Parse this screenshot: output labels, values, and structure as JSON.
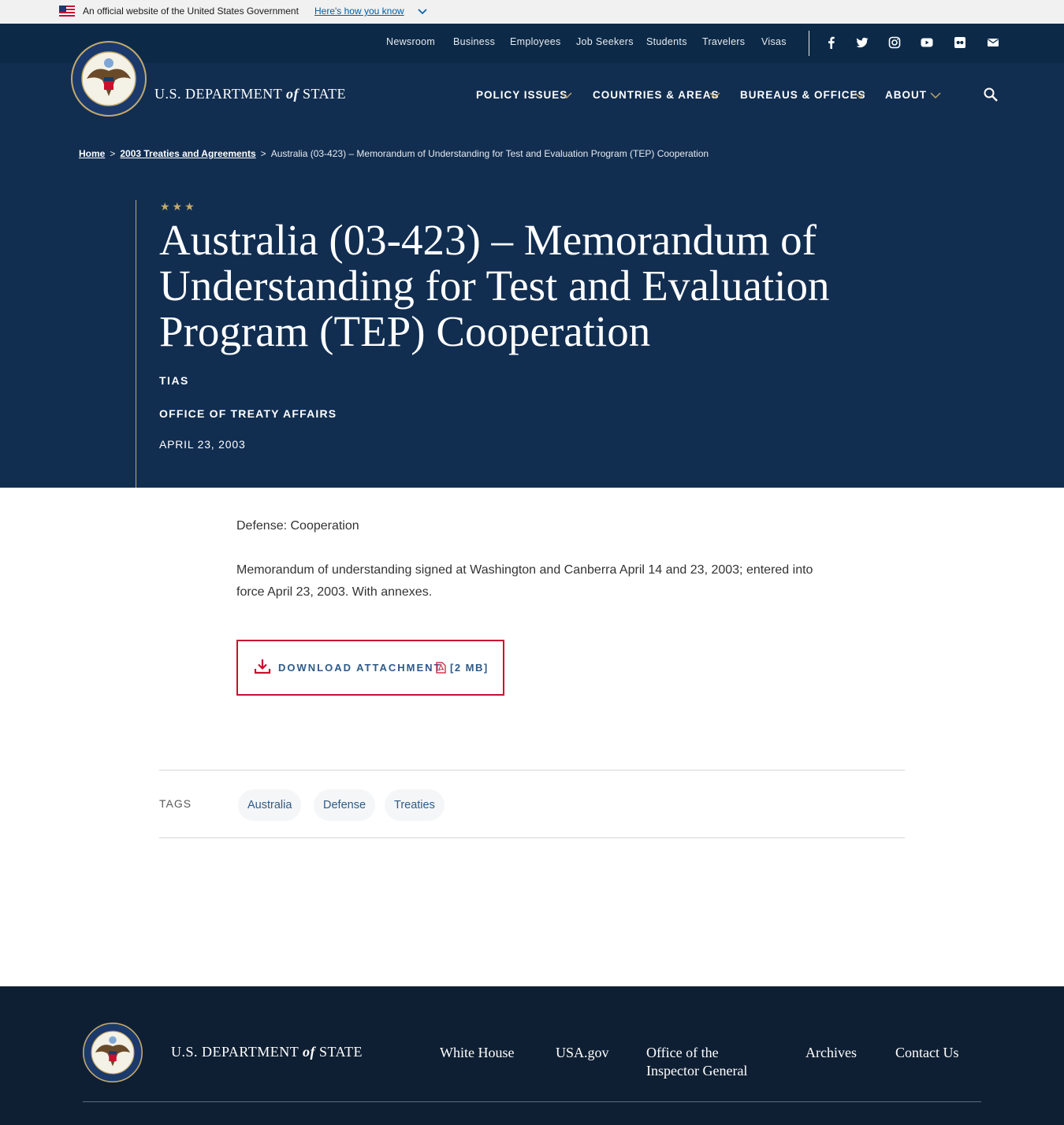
{
  "gov_banner": {
    "text": "An official website of the United States Government",
    "link": "Here's how you know"
  },
  "utility_nav": [
    "Newsroom",
    "Business",
    "Employees",
    "Job Seekers",
    "Students",
    "Travelers",
    "Visas"
  ],
  "social_icons": [
    "facebook-icon",
    "twitter-icon",
    "instagram-icon",
    "youtube-icon",
    "flickr-icon",
    "email-icon"
  ],
  "brand": {
    "pre": "U.S. DEPARTMENT",
    "of": "of",
    "post": "STATE"
  },
  "main_nav": [
    "POLICY ISSUES",
    "COUNTRIES & AREAS",
    "BUREAUS & OFFICES",
    "ABOUT"
  ],
  "breadcrumb": {
    "home": "Home",
    "parent": "2003 Treaties and Agreements",
    "sep": ">",
    "current": "Australia (03-423) – Memorandum of Understanding for Test and Evaluation Program (TEP) Cooperation"
  },
  "stars": "★★★",
  "page": {
    "title": "Australia (03-423) – Memorandum of Understanding for Test and Evaluation Program (TEP) Cooperation",
    "series": "TIAS",
    "office": "OFFICE OF TREATY AFFAIRS",
    "date": "APRIL 23, 2003"
  },
  "content": {
    "subject": "Defense: Cooperation",
    "description": "Memorandum of understanding signed at Washington and Canberra April 14 and 23, 2003; entered into force April 23, 2003. With annexes."
  },
  "download": {
    "label": "DOWNLOAD ATTACHMENT",
    "size": "[2 MB]"
  },
  "tags": {
    "label": "TAGS",
    "items": [
      "Australia",
      "Defense",
      "Treaties"
    ]
  },
  "footer": {
    "links": [
      "White House",
      "USA.gov",
      "Office of the Inspector General",
      "Archives",
      "Contact Us"
    ]
  },
  "colors": {
    "navy": "#112e51",
    "utility": "#0c2a48",
    "accent_red": "#c8102e",
    "gold": "#c5a96b",
    "link_blue": "#2e5a88",
    "footer": "#0f1f33"
  }
}
